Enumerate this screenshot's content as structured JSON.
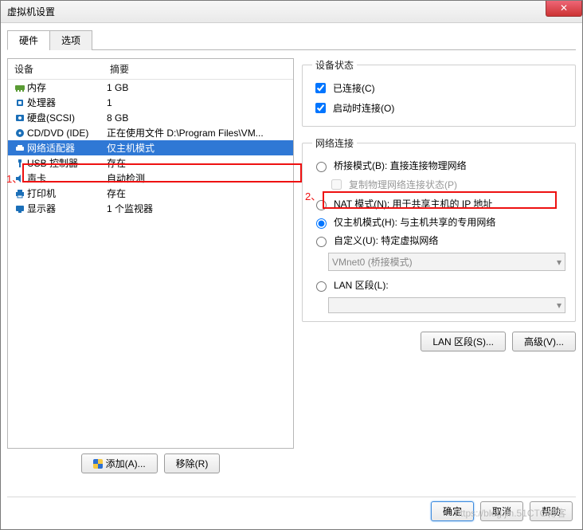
{
  "window": {
    "title": "虚拟机设置"
  },
  "tabs": {
    "hardware": "硬件",
    "options": "选项"
  },
  "hw_headers": {
    "device": "设备",
    "summary": "摘要"
  },
  "hw": [
    {
      "icon": "memory",
      "label": "内存",
      "summary": "1 GB"
    },
    {
      "icon": "cpu",
      "label": "处理器",
      "summary": "1"
    },
    {
      "icon": "disk",
      "label": "硬盘(SCSI)",
      "summary": "8 GB"
    },
    {
      "icon": "cd",
      "label": "CD/DVD (IDE)",
      "summary": "正在使用文件 D:\\Program Files\\VM..."
    },
    {
      "icon": "net",
      "label": "网络适配器",
      "summary": "仅主机模式"
    },
    {
      "icon": "usb",
      "label": "USB 控制器",
      "summary": "存在"
    },
    {
      "icon": "sound",
      "label": "声卡",
      "summary": "自动检测"
    },
    {
      "icon": "printer",
      "label": "打印机",
      "summary": "存在"
    },
    {
      "icon": "display",
      "label": "显示器",
      "summary": "1 个监视器"
    }
  ],
  "selected_index": 4,
  "ann": {
    "one": "1、",
    "two": "2、"
  },
  "status": {
    "legend": "设备状态",
    "connected": "已连接(C)",
    "connect_at_poweron": "启动时连接(O)"
  },
  "net": {
    "legend": "网络连接",
    "bridged": "桥接模式(B): 直接连接物理网络",
    "replicate": "复制物理网络连接状态(P)",
    "nat": "NAT 模式(N): 用于共享主机的 IP 地址",
    "hostonly": "仅主机模式(H): 与主机共享的专用网络",
    "custom": "自定义(U): 特定虚拟网络",
    "vmnet_sel": "VMnet0 (桥接模式)",
    "lan": "LAN 区段(L):"
  },
  "right_btns": {
    "lan_segments": "LAN 区段(S)...",
    "advanced": "高级(V)..."
  },
  "bottom": {
    "add": "添加(A)...",
    "remove": "移除(R)"
  },
  "actions": {
    "ok": "确定",
    "cancel": "取消",
    "help": "帮助"
  },
  "watermark": "https://blog.jin.51CTO博客"
}
